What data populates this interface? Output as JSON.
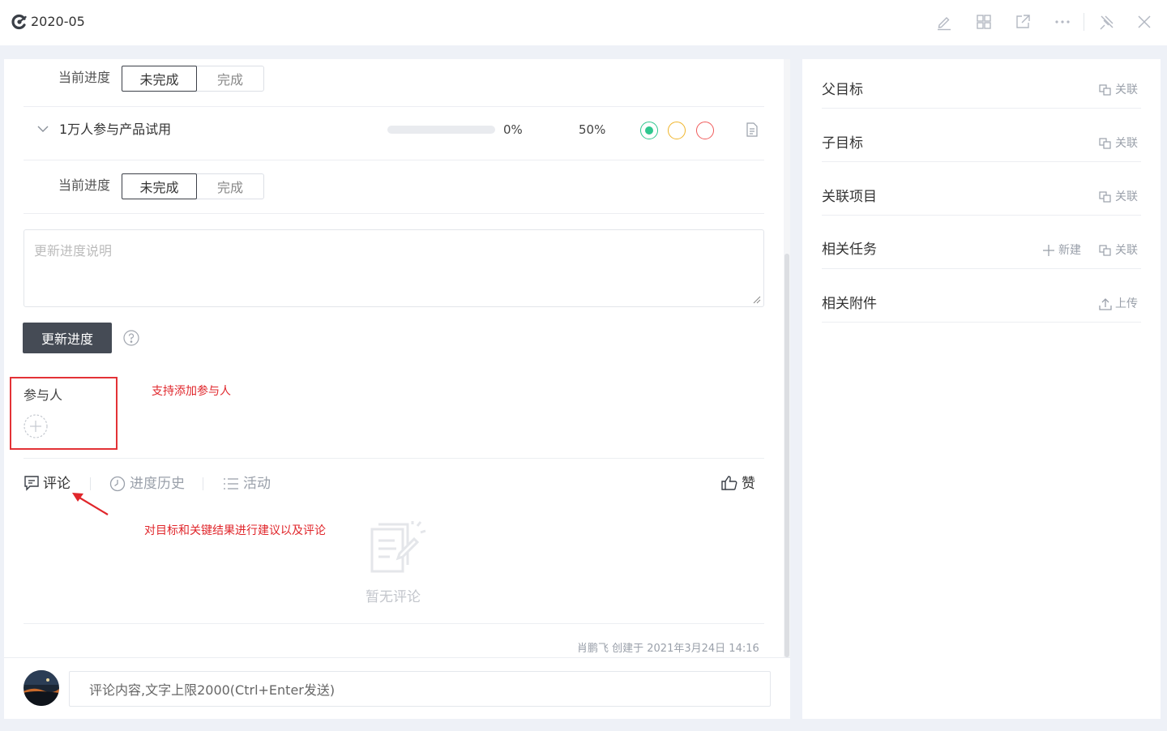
{
  "window": {
    "title": "2020-05",
    "icons": [
      "logo-icon",
      "edit-icon",
      "grid-icon",
      "share-icon",
      "more-icon",
      "pin-icon",
      "close-icon"
    ]
  },
  "main": {
    "kr1": {
      "progress_label": "当前进度",
      "seg_incomplete": "未完成",
      "seg_complete": "完成"
    },
    "kr2": {
      "title": "1万人参与产品试用",
      "progress": 0,
      "progress_text": "0%",
      "weight_text": "50%",
      "status_colors": [
        "#2fc78f",
        "#f0b429",
        "#f05a5a"
      ],
      "progress_label": "当前进度",
      "seg_incomplete": "未完成",
      "seg_complete": "完成"
    },
    "description_placeholder": "更新进度说明",
    "update_button": "更新进度",
    "participants": {
      "label": "参与人",
      "annotation": "支持添加参与人"
    },
    "tabs": {
      "comment": "评论",
      "history": "进度历史",
      "activity": "活动",
      "like": "赞"
    },
    "comment_annotation": "对目标和关键结果进行建议以及评论",
    "empty_comments": "暂无评论",
    "created_info": "肖鹏飞 创建于 2021年3月24日 14:16",
    "comment_placeholder": "评论内容,文字上限2000(Ctrl+Enter发送)"
  },
  "sidebar": {
    "items": [
      {
        "label": "父目标",
        "action": "关联"
      },
      {
        "label": "子目标",
        "action": "关联"
      },
      {
        "label": "关联项目",
        "action": "关联"
      },
      {
        "label": "相关任务",
        "new": "新建",
        "action": "关联"
      },
      {
        "label": "相关附件",
        "action": "上传"
      }
    ]
  },
  "colors": {
    "accent_dark": "#454b55",
    "annotation_red": "#e0262b",
    "status_green": "#2fc78f",
    "status_yellow": "#f0b429",
    "status_red": "#f05a5a"
  }
}
